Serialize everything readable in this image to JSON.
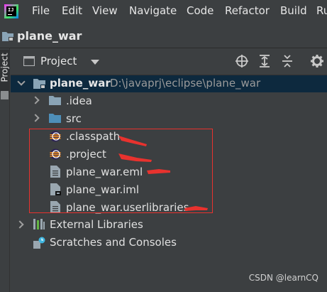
{
  "menu": {
    "items": [
      "File",
      "Edit",
      "View",
      "Navigate",
      "Code",
      "Refactor",
      "Build",
      "Ru"
    ]
  },
  "nav": {
    "project_name": "plane_war"
  },
  "side_stripe": {
    "label": "Project"
  },
  "tool_window": {
    "title": "Project"
  },
  "tree": {
    "root_name": "plane_war",
    "root_path": "D:\\javaprj\\eclipse\\plane_war",
    "items": [
      {
        "label": ".idea",
        "type": "folder"
      },
      {
        "label": "src",
        "type": "source-folder"
      },
      {
        "label": ".classpath",
        "type": "eclipse-file"
      },
      {
        "label": ".project",
        "type": "eclipse-file"
      },
      {
        "label": "plane_war.eml",
        "type": "text-file"
      },
      {
        "label": "plane_war.iml",
        "type": "module-file"
      },
      {
        "label": "plane_war.userlibraries",
        "type": "text-file"
      }
    ],
    "external_libraries": "External Libraries",
    "scratches": "Scratches and Consoles"
  },
  "watermark": "CSDN @learnCQ",
  "colors": {
    "background": "#3c3f41",
    "selection": "#0d293e",
    "annotation": "#e8322e",
    "folder": "#8aa4b6",
    "source_folder": "#4e8fb9"
  }
}
